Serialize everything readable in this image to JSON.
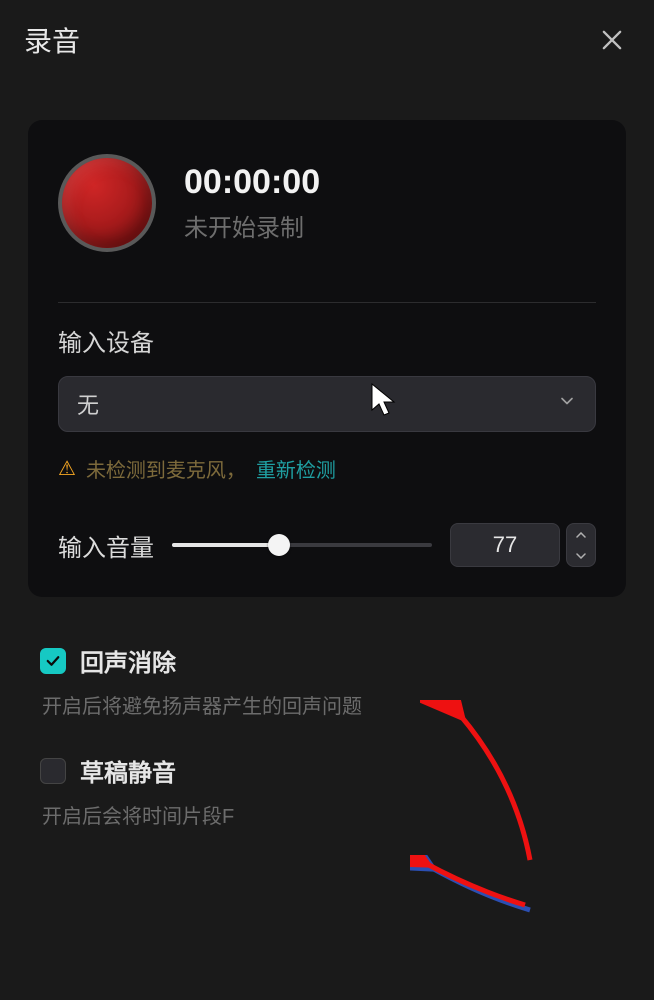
{
  "header": {
    "title": "录音"
  },
  "recorder": {
    "timer": "00:00:00",
    "status": "未开始录制"
  },
  "input_device": {
    "label": "输入设备",
    "selected": "无",
    "warning_text": "未检测到麦克风，",
    "retry_link": "重新检测"
  },
  "volume": {
    "label": "输入音量",
    "value": "77"
  },
  "options": {
    "echo": {
      "title": "回声消除",
      "desc": "开启后将避免扬声器产生的回声问题",
      "checked": true
    },
    "mute_draft": {
      "title": "草稿静音",
      "desc": "开启后会将时间片段F",
      "checked": false
    }
  }
}
